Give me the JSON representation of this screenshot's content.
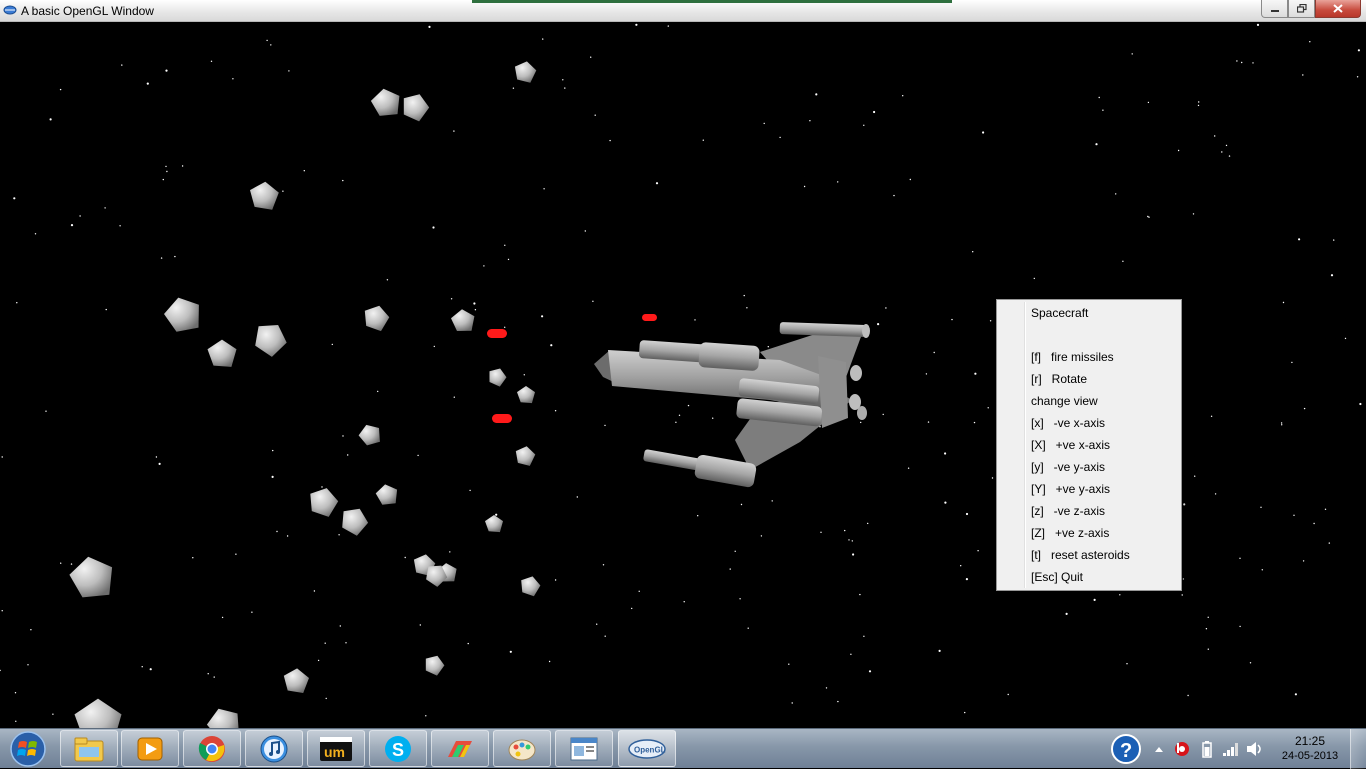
{
  "window": {
    "title": "A basic OpenGL Window"
  },
  "context_menu": {
    "items": [
      {
        "label": "Spacecraft"
      },
      {
        "label": ""
      },
      {
        "label": "[f]   fire missiles"
      },
      {
        "label": "[r]   Rotate"
      },
      {
        "label": "change view"
      },
      {
        "label": "[x]   -ve x-axis"
      },
      {
        "label": "[X]   +ve x-axis"
      },
      {
        "label": "[y]   -ve y-axis"
      },
      {
        "label": "[Y]   +ve y-axis"
      },
      {
        "label": "[z]   -ve z-axis"
      },
      {
        "label": "[Z]   +ve z-axis"
      },
      {
        "label": "[t]   reset asteroids"
      },
      {
        "label": "[Esc] Quit"
      }
    ]
  },
  "taskbar": {
    "apps": [
      {
        "icon": "windows-explorer-icon"
      },
      {
        "icon": "media-player-icon"
      },
      {
        "icon": "chrome-icon"
      },
      {
        "icon": "itunes-icon"
      },
      {
        "icon": "um-player-icon"
      },
      {
        "icon": "skype-icon"
      },
      {
        "icon": "colorful-app-icon"
      },
      {
        "icon": "paint-icon"
      },
      {
        "icon": "window-app-icon"
      },
      {
        "icon": "opengl-icon",
        "label": "OpenGL"
      }
    ],
    "clock_time": "21:25",
    "clock_date": "24-05-2013"
  },
  "colors": {
    "missile": "#ff1a1a",
    "ship": "#9a9a9a",
    "asteroid": "#c8c8c8",
    "space": "#000000"
  }
}
